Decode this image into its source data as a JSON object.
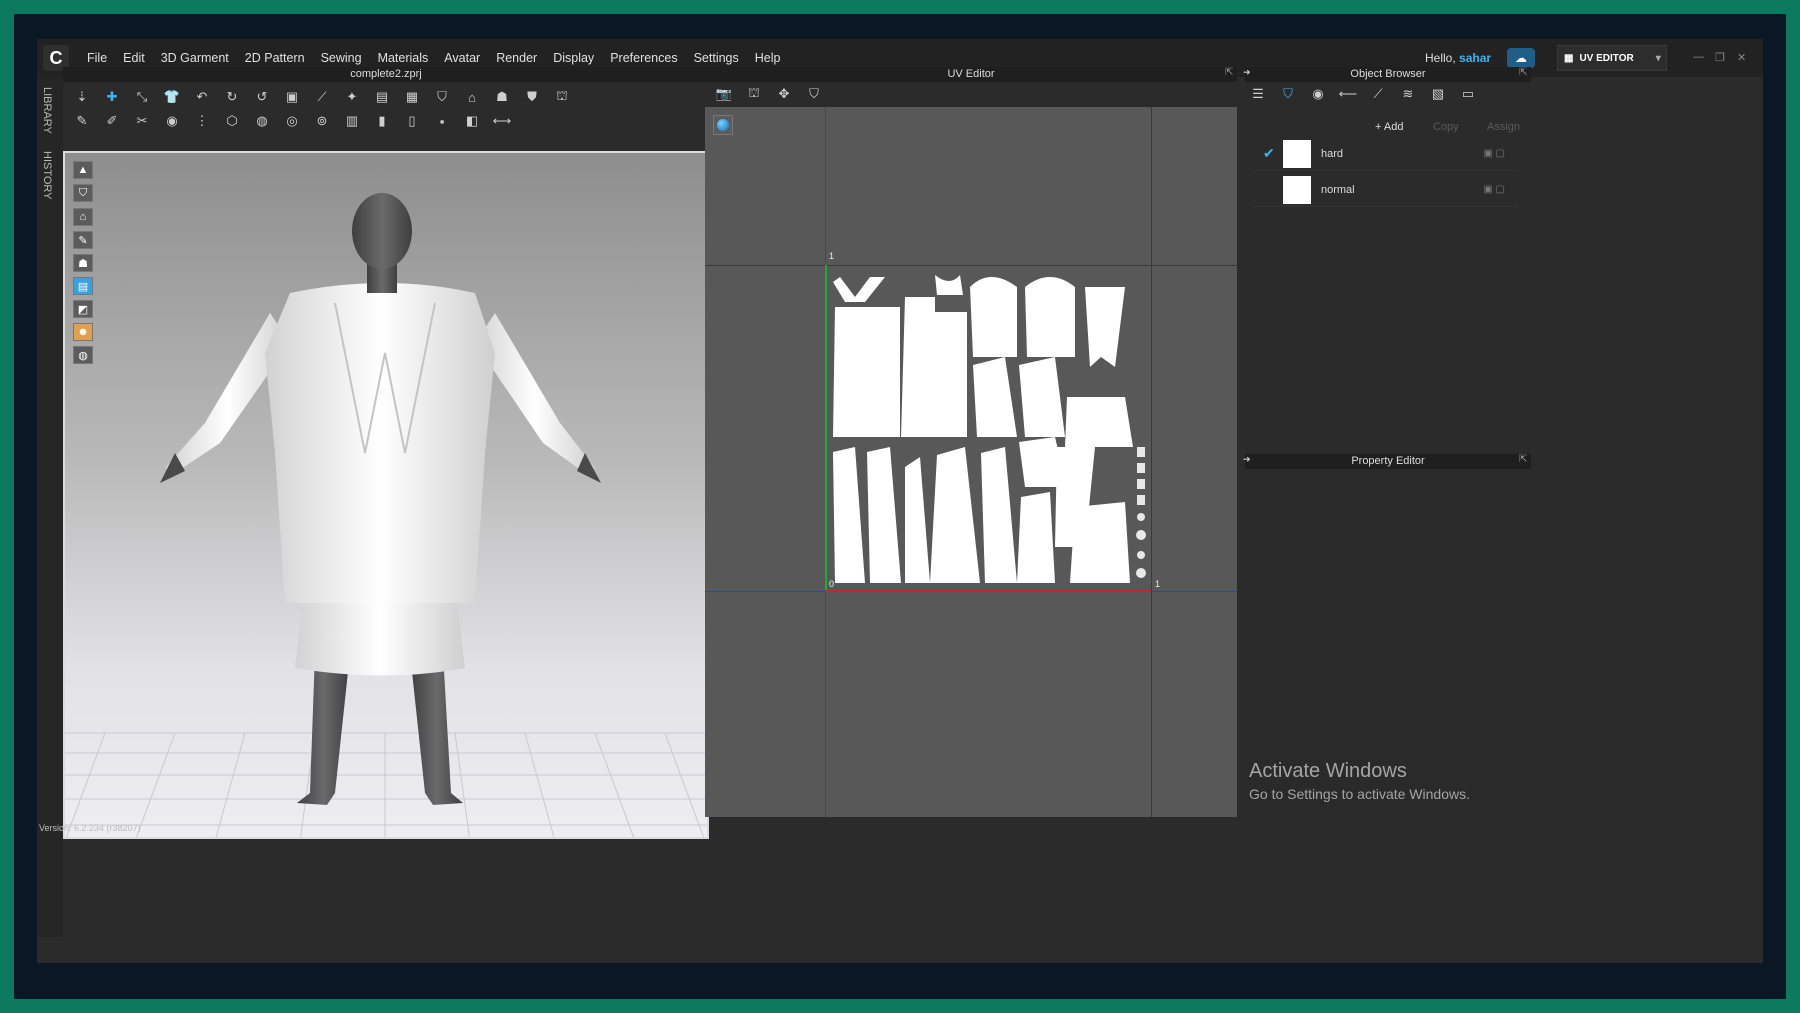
{
  "menubar": {
    "logo": "C",
    "items": [
      "File",
      "Edit",
      "3D Garment",
      "2D Pattern",
      "Sewing",
      "Materials",
      "Avatar",
      "Render",
      "Display",
      "Preferences",
      "Settings",
      "Help"
    ],
    "greeting": "Hello,",
    "user": "sahar",
    "mode": "UV EDITOR"
  },
  "sidetabs": [
    "LIBRARY",
    "HISTORY"
  ],
  "viewport3d": {
    "title": "complete2.zprj"
  },
  "uv_editor": {
    "title": "UV Editor",
    "axis_labels": [
      "1",
      "0",
      "1"
    ]
  },
  "object_browser": {
    "title": "Object Browser",
    "add_label": "Add",
    "copy_label": "Copy",
    "assign_label": "Assign",
    "items": [
      {
        "name": "hard",
        "checked": true
      },
      {
        "name": "normal",
        "checked": false
      }
    ]
  },
  "property_editor": {
    "title": "Property Editor"
  },
  "watermark": {
    "line1": "Activate Windows",
    "line2": "Go to Settings to activate Windows."
  },
  "status": {
    "version": "Version: 6.2.234 (r38207)"
  },
  "colors": {
    "accent": "#3ab4f2",
    "outer_frame": "#0b7a5e",
    "uv_x_axis": "#cc2222",
    "uv_y_axis": "#22aa33",
    "uv_grid_blue": "#2244cc"
  }
}
